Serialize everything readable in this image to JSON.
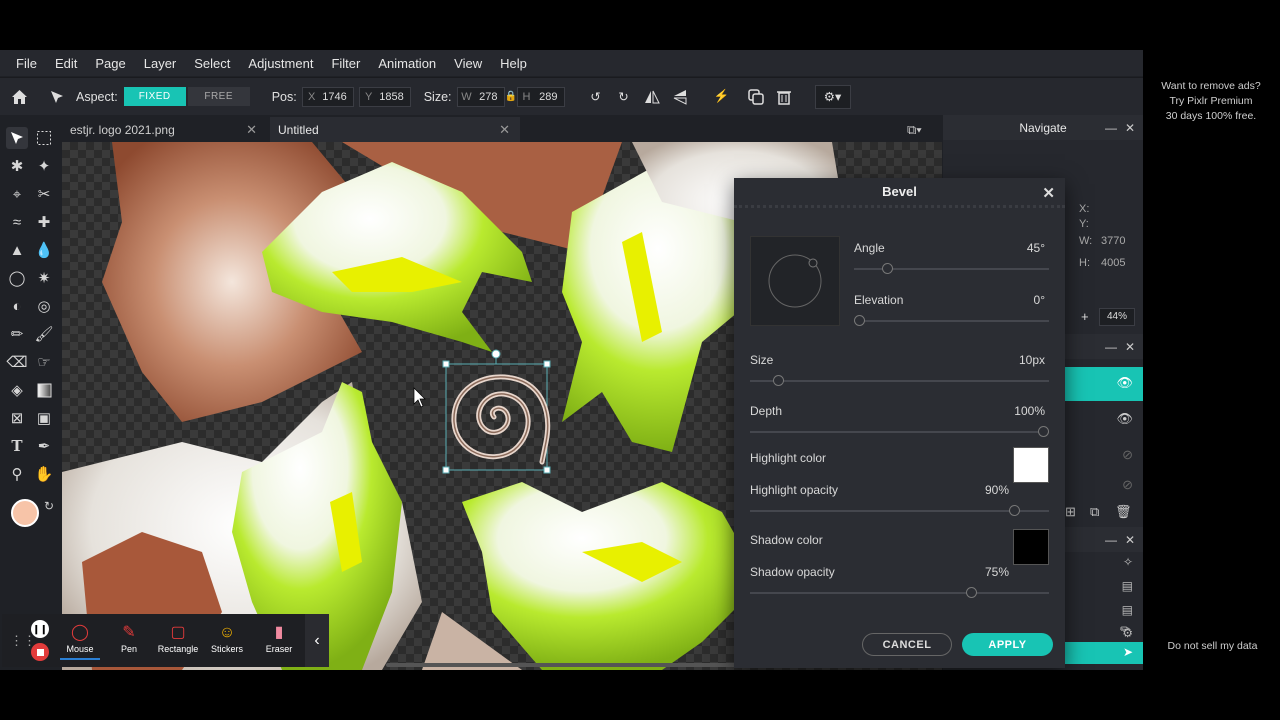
{
  "menu": [
    "File",
    "Edit",
    "Page",
    "Layer",
    "Select",
    "Adjustment",
    "Filter",
    "Animation",
    "View",
    "Help"
  ],
  "toolbar": {
    "aspect_label": "Aspect:",
    "fixed_label": "FIXED",
    "free_label": "FREE",
    "pos_label": "Pos:",
    "pos_x_key": "X",
    "pos_x": "1746",
    "pos_y_key": "Y",
    "pos_y": "1858",
    "size_label": "Size:",
    "size_w_key": "W",
    "size_w": "278",
    "size_h_key": "H",
    "size_h": "289"
  },
  "tabs": [
    {
      "label": "estjr. logo 2021.png"
    },
    {
      "label": "Untitled"
    }
  ],
  "navigate": {
    "title": "Navigate",
    "x_label": "X:",
    "y_label": "Y:",
    "w_label": "W:",
    "w_value": "3770",
    "h_label": "H:",
    "h_value": "4005",
    "zoom": "44%"
  },
  "bevel": {
    "title": "Bevel",
    "angle_label": "Angle",
    "angle_value": "45°",
    "angle_fraction": 0.15,
    "elevation_label": "Elevation",
    "elevation_value": "0°",
    "elevation_fraction": 0.0,
    "size_label": "Size",
    "size_value": "10px",
    "size_fraction": 0.08,
    "depth_label": "Depth",
    "depth_value": "100%",
    "depth_fraction": 1.0,
    "highlight_color_label": "Highlight color",
    "highlight_color": "#ffffff",
    "highlight_opacity_label": "Highlight opacity",
    "highlight_opacity_value": "90%",
    "highlight_opacity_fraction": 0.9,
    "shadow_color_label": "Shadow color",
    "shadow_color": "#000000",
    "shadow_opacity_label": "Shadow opacity",
    "shadow_opacity_value": "75%",
    "shadow_opacity_fraction": 0.75,
    "cancel_label": "CANCEL",
    "apply_label": "APPLY"
  },
  "recorder": {
    "items": [
      "Mouse",
      "Pen",
      "Rectangle",
      "Stickers",
      "Eraser"
    ]
  },
  "ads": {
    "line1": "Want to remove ads?",
    "line2": "Try Pixlr Premium",
    "line3": "30 days 100% free.",
    "do_not_sell": "Do not sell my data"
  },
  "colors": {
    "accent": "#18c4b4",
    "primary_swatch": "#f7c4a8",
    "secondary_swatch": "#000000",
    "brown": "#a0583b",
    "lime": "#a6e02a",
    "yellow": "#e8f000"
  }
}
